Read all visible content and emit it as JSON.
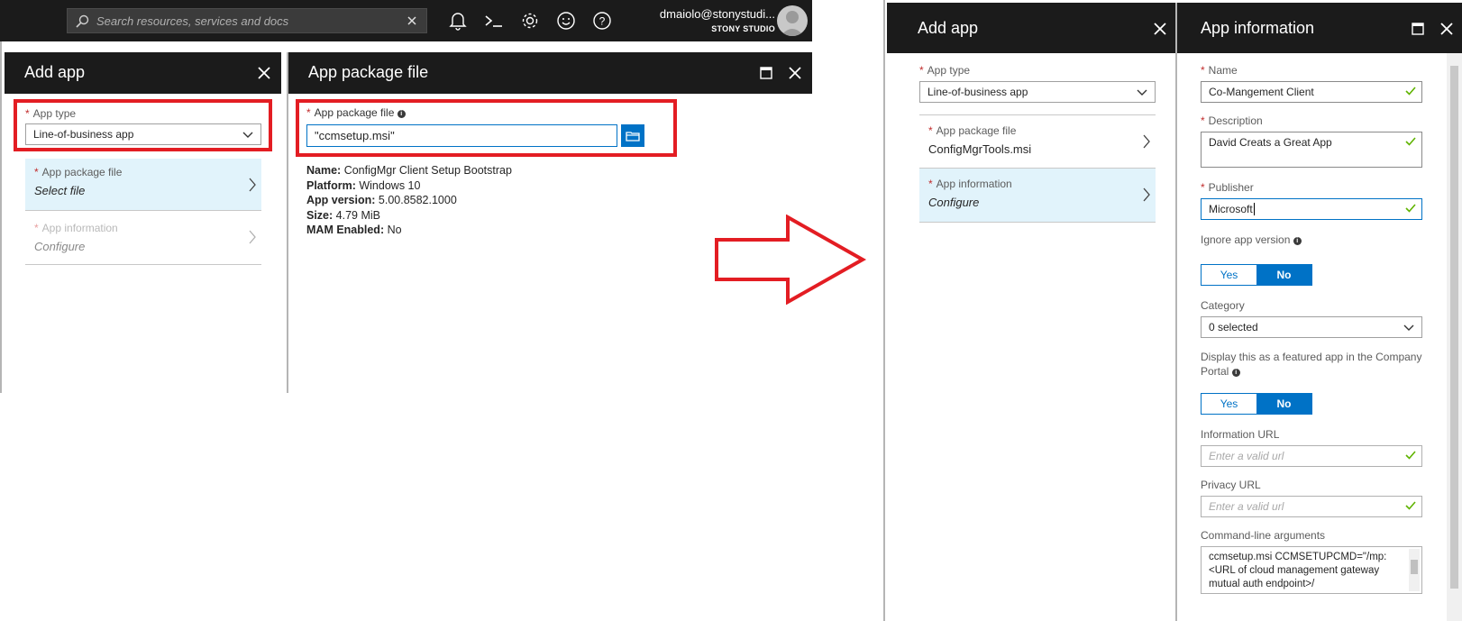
{
  "topbar": {
    "search_placeholder": "Search resources, services and docs",
    "user_name": "dmaiolo@stonystudi...",
    "user_org": "STONY STUDIO"
  },
  "left": {
    "add_app": {
      "title": "Add app",
      "app_type_label": "App type",
      "app_type_value": "Line-of-business app",
      "package_label": "App package file",
      "package_value": "Select file",
      "info_label": "App information",
      "info_value": "Configure"
    },
    "package": {
      "title": "App package file",
      "field_label": "App package file",
      "field_value": "\"ccmsetup.msi\"",
      "details": [
        {
          "k": "Name:",
          "v": "ConfigMgr Client Setup Bootstrap"
        },
        {
          "k": "Platform:",
          "v": "Windows 10"
        },
        {
          "k": "App version:",
          "v": "5.00.8582.1000"
        },
        {
          "k": "Size:",
          "v": "4.79 MiB"
        },
        {
          "k": "MAM Enabled:",
          "v": "No"
        }
      ]
    }
  },
  "right": {
    "add_app": {
      "title": "Add app",
      "app_type_label": "App type",
      "app_type_value": "Line-of-business app",
      "package_label": "App package file",
      "package_value": "ConfigMgrTools.msi",
      "info_label": "App information",
      "info_value": "Configure"
    },
    "info": {
      "title": "App information",
      "name_label": "Name",
      "name_value": "Co-Mangement Client",
      "desc_label": "Description",
      "desc_value": "David Creats a Great App",
      "publisher_label": "Publisher",
      "publisher_value": "Microsoft",
      "ignore_label": "Ignore app version",
      "yes": "Yes",
      "no": "No",
      "category_label": "Category",
      "category_value": "0 selected",
      "featured_label": "Display this as a featured app in the Company Portal",
      "info_url_label": "Information URL",
      "info_url_placeholder": "Enter a valid url",
      "privacy_url_label": "Privacy URL",
      "privacy_url_placeholder": "Enter a valid url",
      "cmd_label": "Command-line arguments",
      "cmd_value": "ccmsetup.msi CCMSETUPCMD=\"/mp:<URL of cloud management gateway mutual auth endpoint>/"
    }
  },
  "colors": {
    "accent": "#0072c6",
    "highlight": "#e31d23",
    "header": "#1b1b1b",
    "active_row": "#e1f3fb",
    "valid": "#5fb300"
  }
}
